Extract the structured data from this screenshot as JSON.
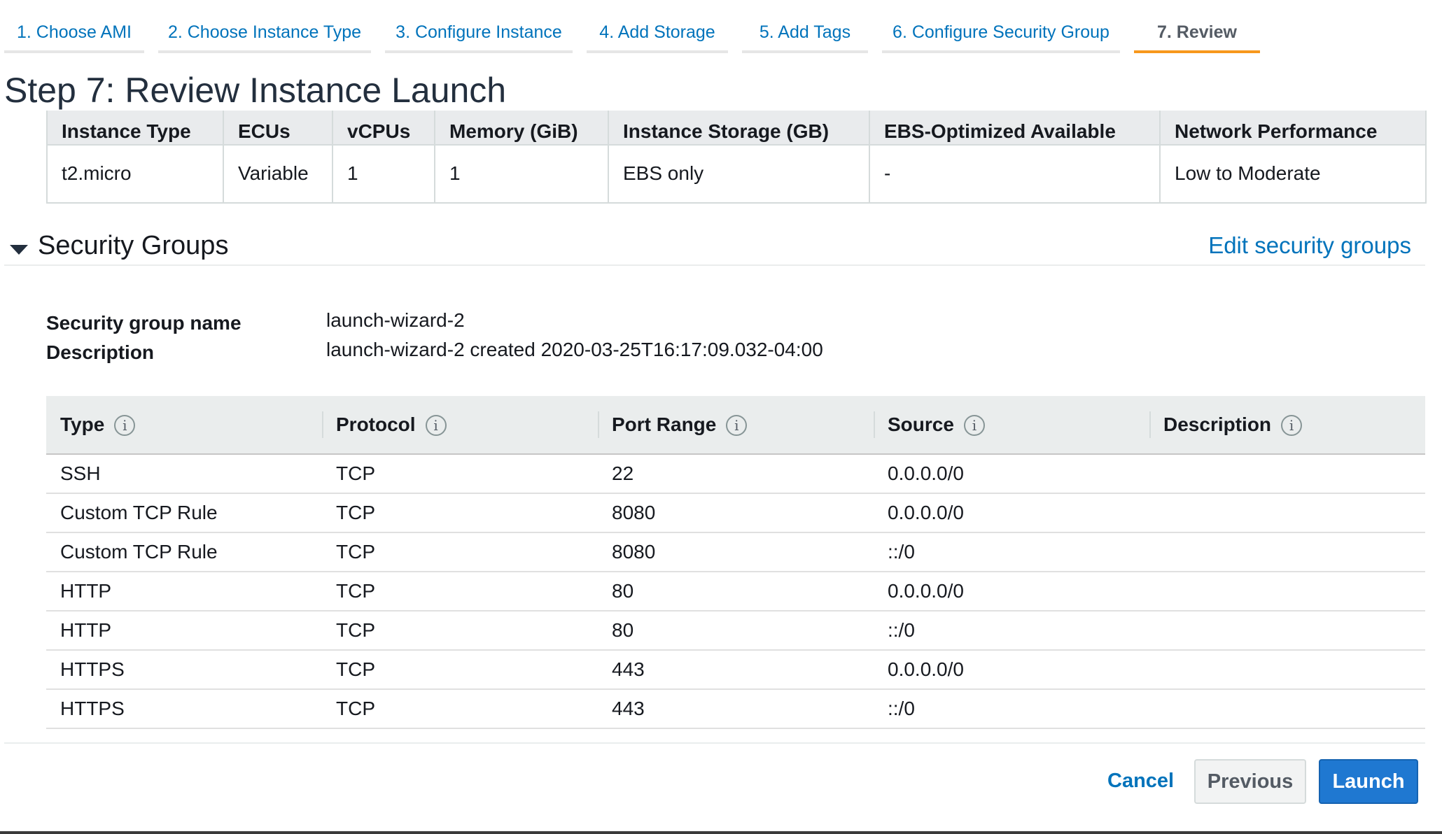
{
  "wizard_tabs": [
    {
      "label": "1. Choose AMI"
    },
    {
      "label": "2. Choose Instance Type"
    },
    {
      "label": "3. Configure Instance"
    },
    {
      "label": "4. Add Storage"
    },
    {
      "label": "5. Add Tags"
    },
    {
      "label": "6. Configure Security Group"
    },
    {
      "label": "7. Review",
      "active": true
    }
  ],
  "page_title": "Step 7: Review Instance Launch",
  "instance_type_table": {
    "headers": [
      "Instance Type",
      "ECUs",
      "vCPUs",
      "Memory (GiB)",
      "Instance Storage (GB)",
      "EBS-Optimized Available",
      "Network Performance"
    ],
    "row": [
      "t2.micro",
      "Variable",
      "1",
      "1",
      "EBS only",
      "-",
      "Low to Moderate"
    ]
  },
  "security_groups": {
    "title": "Security Groups",
    "edit_link": "Edit security groups",
    "name_label": "Security group name",
    "name_value": "launch-wizard-2",
    "description_label": "Description",
    "description_value": "launch-wizard-2 created 2020-03-25T16:17:09.032-04:00",
    "info_glyph": "i",
    "columns": [
      "Type",
      "Protocol",
      "Port Range",
      "Source",
      "Description"
    ],
    "rules": [
      [
        "SSH",
        "TCP",
        "22",
        "0.0.0.0/0",
        ""
      ],
      [
        "Custom TCP Rule",
        "TCP",
        "8080",
        "0.0.0.0/0",
        ""
      ],
      [
        "Custom TCP Rule",
        "TCP",
        "8080",
        "::/0",
        ""
      ],
      [
        "HTTP",
        "TCP",
        "80",
        "0.0.0.0/0",
        ""
      ],
      [
        "HTTP",
        "TCP",
        "80",
        "::/0",
        ""
      ],
      [
        "HTTPS",
        "TCP",
        "443",
        "0.0.0.0/0",
        ""
      ],
      [
        "HTTPS",
        "TCP",
        "443",
        "::/0",
        ""
      ]
    ]
  },
  "footer": {
    "cancel_label": "Cancel",
    "previous_label": "Previous",
    "launch_label": "Launch"
  },
  "colors": {
    "link": "#0073bb",
    "active_tab_underline": "#f7981c",
    "primary_button": "#1f78d1"
  }
}
